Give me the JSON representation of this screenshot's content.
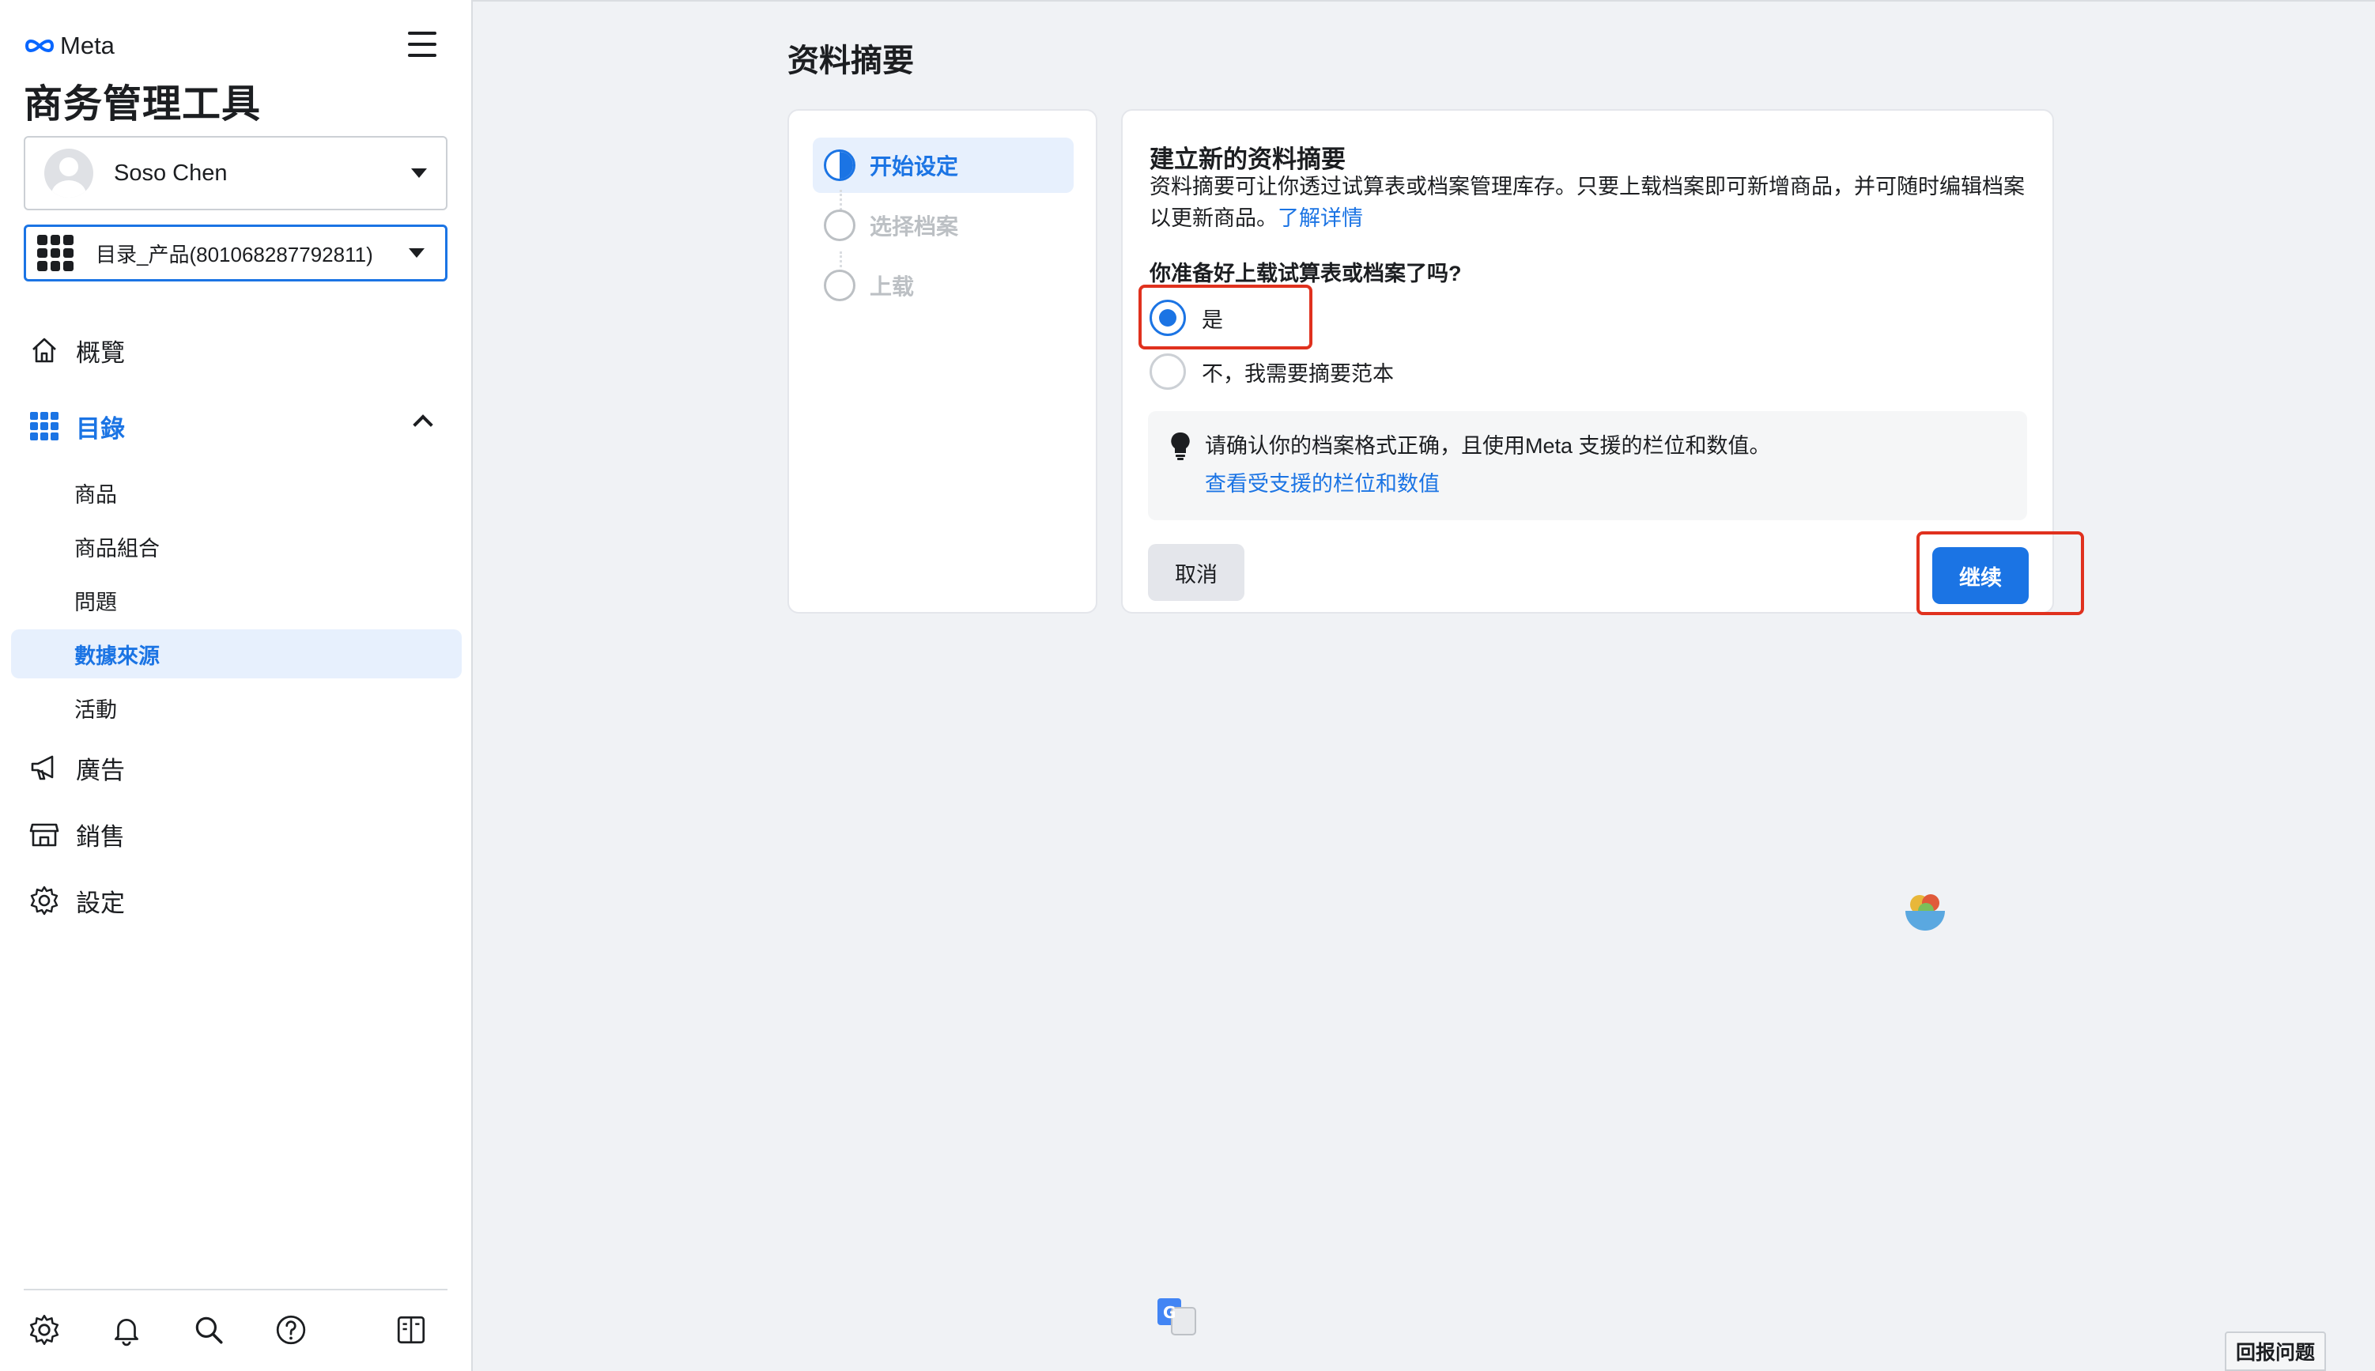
{
  "brand": {
    "logo_text": "Meta"
  },
  "app": {
    "title": "商务管理工具"
  },
  "account": {
    "name": "Soso Chen"
  },
  "catalog": {
    "name": "目录_产品(801068287792811)"
  },
  "nav": {
    "overview": "概覽",
    "catalog": "目錄",
    "catalog_children": [
      "商品",
      "商品組合",
      "問題",
      "數據來源",
      "活動"
    ],
    "selected_child": "數據來源",
    "ads": "廣告",
    "sales": "銷售",
    "settings": "設定"
  },
  "footer_icons": [
    "gear-icon",
    "bell-icon",
    "search-icon",
    "help-icon",
    "panel-toggle-icon"
  ],
  "page": {
    "title": "资料摘要"
  },
  "steps": [
    {
      "label": "开始设定",
      "state": "current"
    },
    {
      "label": "选择档案",
      "state": "pending"
    },
    {
      "label": "上载",
      "state": "pending"
    }
  ],
  "card": {
    "heading": "建立新的资料摘要",
    "description": "资料摘要可让你透过试算表或档案管理库存。只要上载档案即可新增商品，并可随时编辑档案以更新商品。",
    "learn_more": "了解详情",
    "question": "你准备好上载试算表或档案了吗?",
    "options": [
      {
        "label": "是",
        "checked": true
      },
      {
        "label": "不，我需要摘要范本",
        "checked": false
      }
    ],
    "note": "请确认你的档案格式正确，且使用Meta 支援的栏位和数值。",
    "note_link": "查看受支援的栏位和数值",
    "cancel": "取消",
    "continue": "继续"
  },
  "report": {
    "label": "回报问题"
  },
  "colors": {
    "accent": "#1b74e4",
    "highlight": "#e0311e",
    "background": "#f0f2f5"
  }
}
